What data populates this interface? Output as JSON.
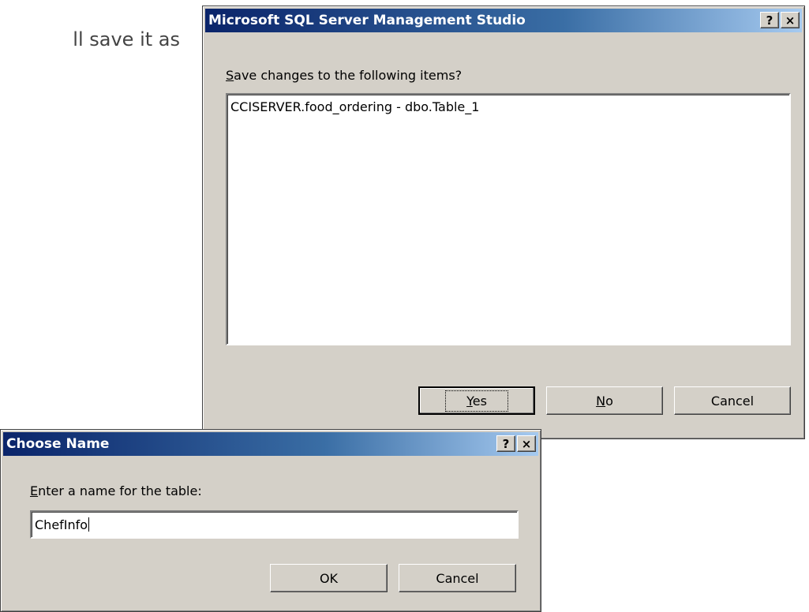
{
  "background": {
    "partial_text": "ll save it as"
  },
  "ssms_dialog": {
    "title": "Microsoft SQL Server Management Studio",
    "help_button": "?",
    "close_button": "×",
    "prompt_label": "Save changes to the following items?",
    "prompt_mnemonic": "S",
    "prompt_rest": "ave changes to the following items?",
    "items": [
      "CCISERVER.food_ordering - dbo.Table_1"
    ],
    "buttons": {
      "yes_mnemonic": "Y",
      "yes_rest": "es",
      "no_mnemonic": "N",
      "no_rest": "o",
      "cancel": "Cancel"
    }
  },
  "choose_name_dialog": {
    "title": "Choose Name",
    "help_button": "?",
    "close_button": "×",
    "prompt_mnemonic": "E",
    "prompt_rest": "nter a name for the table:",
    "name_value": "ChefInfo",
    "buttons": {
      "ok": "OK",
      "cancel": "Cancel"
    }
  },
  "colors": {
    "dialog_face": "#d4d0c8",
    "titlebar_start": "#0a246a",
    "titlebar_end": "#a6caf0"
  }
}
